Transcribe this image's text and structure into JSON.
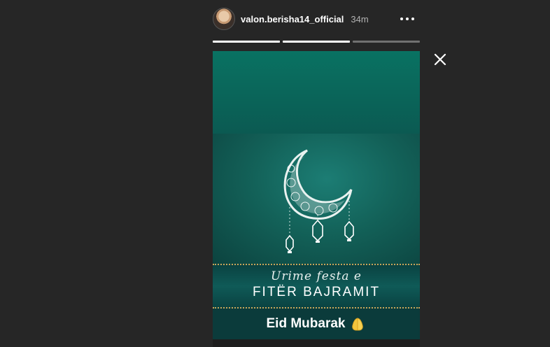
{
  "header": {
    "username": "valon.berisha14_official",
    "time": "34m",
    "avatar_icon": "avatar-icon",
    "more_icon": "more-horizontal-icon"
  },
  "progress": [
    1.0,
    1.0,
    0.0
  ],
  "close_icon": "close-icon",
  "story": {
    "script_line": "Urime festa e",
    "title_line": "FITËR BAJRAMIT",
    "caption": "Eid Mubarak",
    "emoji_icon": "folded-hands-emoji"
  },
  "colors": {
    "background": "#262626",
    "teal": "#0b5a52",
    "gold": "#c9a65a"
  }
}
